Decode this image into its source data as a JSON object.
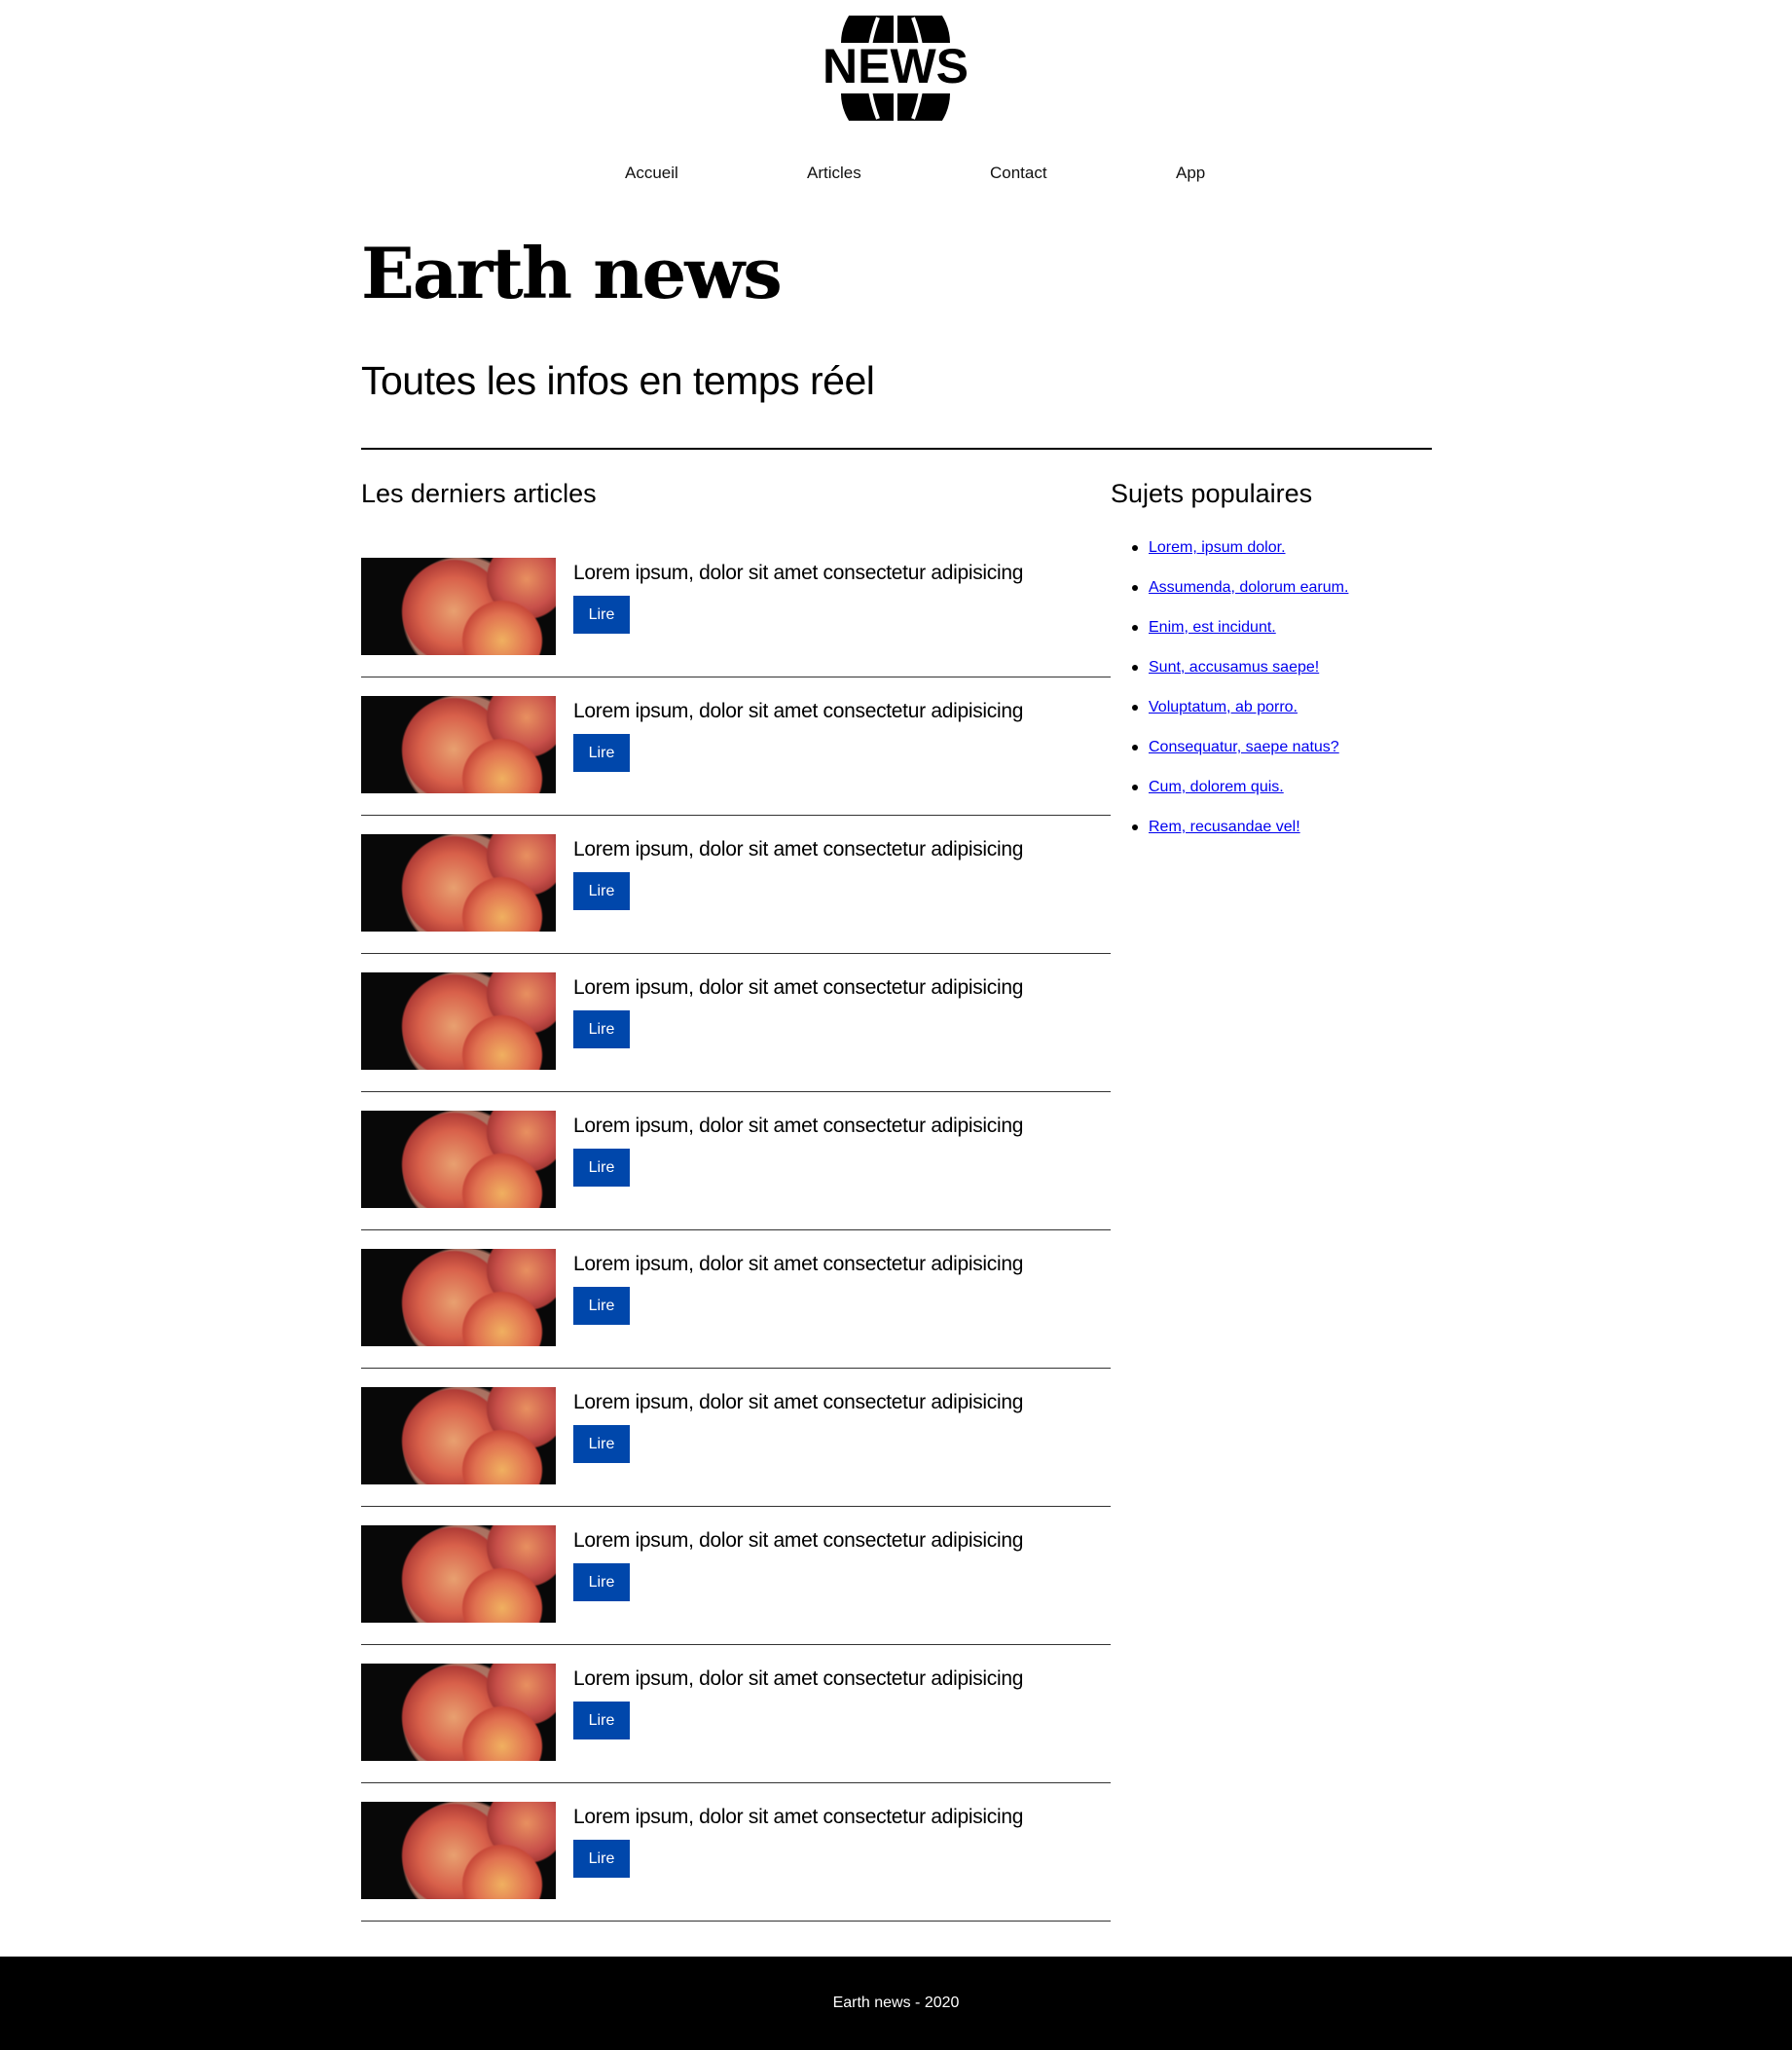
{
  "logo": {
    "text": "NEWS",
    "icon": "globe-icon"
  },
  "nav": [
    {
      "label": "Accueil"
    },
    {
      "label": "Articles"
    },
    {
      "label": "Contact"
    },
    {
      "label": "App"
    }
  ],
  "header": {
    "title": "Earth news",
    "subtitle": "Toutes les infos en temps réel"
  },
  "main": {
    "section_title": "Les derniers articles",
    "articles": [
      {
        "title": "Lorem ipsum, dolor sit amet consectetur adipisicing",
        "button": "Lire"
      },
      {
        "title": "Lorem ipsum, dolor sit amet consectetur adipisicing",
        "button": "Lire"
      },
      {
        "title": "Lorem ipsum, dolor sit amet consectetur adipisicing",
        "button": "Lire"
      },
      {
        "title": "Lorem ipsum, dolor sit amet consectetur adipisicing",
        "button": "Lire"
      },
      {
        "title": "Lorem ipsum, dolor sit amet consectetur adipisicing",
        "button": "Lire"
      },
      {
        "title": "Lorem ipsum, dolor sit amet consectetur adipisicing",
        "button": "Lire"
      },
      {
        "title": "Lorem ipsum, dolor sit amet consectetur adipisicing",
        "button": "Lire"
      },
      {
        "title": "Lorem ipsum, dolor sit amet consectetur adipisicing",
        "button": "Lire"
      },
      {
        "title": "Lorem ipsum, dolor sit amet consectetur adipisicing",
        "button": "Lire"
      },
      {
        "title": "Lorem ipsum, dolor sit amet consectetur adipisicing",
        "button": "Lire"
      }
    ]
  },
  "sidebar": {
    "title": "Sujets populaires",
    "links": [
      "Lorem, ipsum dolor.",
      "Assumenda, dolorum earum.",
      "Enim, est incidunt.",
      "Sunt, accusamus saepe!",
      "Voluptatum, ab porro.",
      "Consequatur, saepe natus?",
      "Cum, dolorem quis.",
      "Rem, recusandae vel!"
    ]
  },
  "footer": {
    "text": "Earth news - 2020"
  },
  "colors": {
    "button": "#0047ab",
    "link": "#0000ee",
    "footer_bg": "#000000"
  }
}
